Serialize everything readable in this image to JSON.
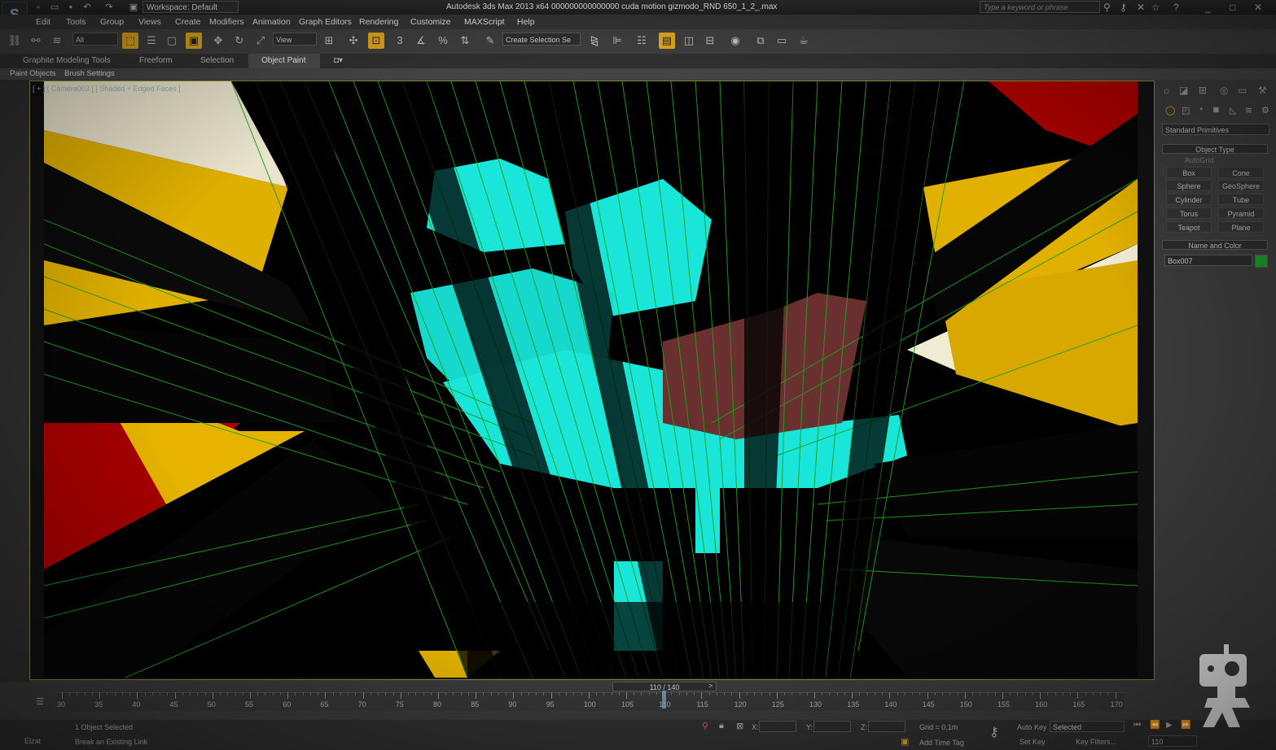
{
  "titlebar": {
    "workspace": "Workspace: Default",
    "title": "Autodesk 3ds Max  2013 x64     000000000000000 cuda motion gizmodo_RND 650_1_2_.max",
    "search_placeholder": "Type a keyword or phrase"
  },
  "menu": [
    "Edit",
    "Tools",
    "Group",
    "Views",
    "Create",
    "Modifiers",
    "Animation",
    "Graph Editors",
    "Rendering",
    "Customize",
    "MAXScript",
    "Help"
  ],
  "toolbar": {
    "selection_filter": "All",
    "reference_coord": "View",
    "selection_set_placeholder": "Create Selection Se",
    "snap_label": "3"
  },
  "ribbon": {
    "tabs": [
      "Graphite Modeling Tools",
      "Freeform",
      "Selection",
      "Object Paint"
    ],
    "active_tab": "Object Paint",
    "subtabs": [
      "Paint Objects",
      "Brush Settings"
    ]
  },
  "viewport": {
    "label": "[ + ] [ Camera003 ] [ Shaded + Edged Faces ]"
  },
  "command_panel": {
    "category": "Standard Primitives",
    "object_type_title": "Object Type",
    "autogrid": "AutoGrid",
    "primitives": [
      "Box",
      "Cone",
      "Sphere",
      "GeoSphere",
      "Cylinder",
      "Tube",
      "Torus",
      "Pyramid",
      "Teapot",
      "Plane"
    ],
    "name_color_title": "Name and Color",
    "object_name": "Box007",
    "object_color": "#1a9a2a"
  },
  "timeline": {
    "frame_display": "110 / 140",
    "ticks": [
      "30",
      "35",
      "40",
      "45",
      "50",
      "55",
      "60",
      "65",
      "70",
      "75",
      "80",
      "85",
      "90",
      "95",
      "100",
      "105",
      "110",
      "115",
      "120",
      "125",
      "130",
      "135",
      "140",
      "145",
      "150",
      "155",
      "160",
      "165",
      "170"
    ],
    "current_frame": 110
  },
  "status": {
    "selection": "1 Object Selected",
    "prompt": "Break an Existing Link",
    "script_label": "Elzat",
    "x_label": "X:",
    "y_label": "Y:",
    "z_label": "Z:",
    "grid": "Grid = 0,1m",
    "add_time_tag": "Add Time Tag",
    "auto_key": "Auto Key",
    "set_key": "Set Key",
    "auto_key_mode": "Selected",
    "key_filters": "Key Filters...",
    "frame_field": "110"
  },
  "colors": {
    "accent": "#d9a21b",
    "viewport_bg": "#000000",
    "mesh_edges": "#22aa22",
    "cyan_text": "#19e6d8",
    "yellow_plane": "#e0b000",
    "red_plane": "#aa0000"
  }
}
